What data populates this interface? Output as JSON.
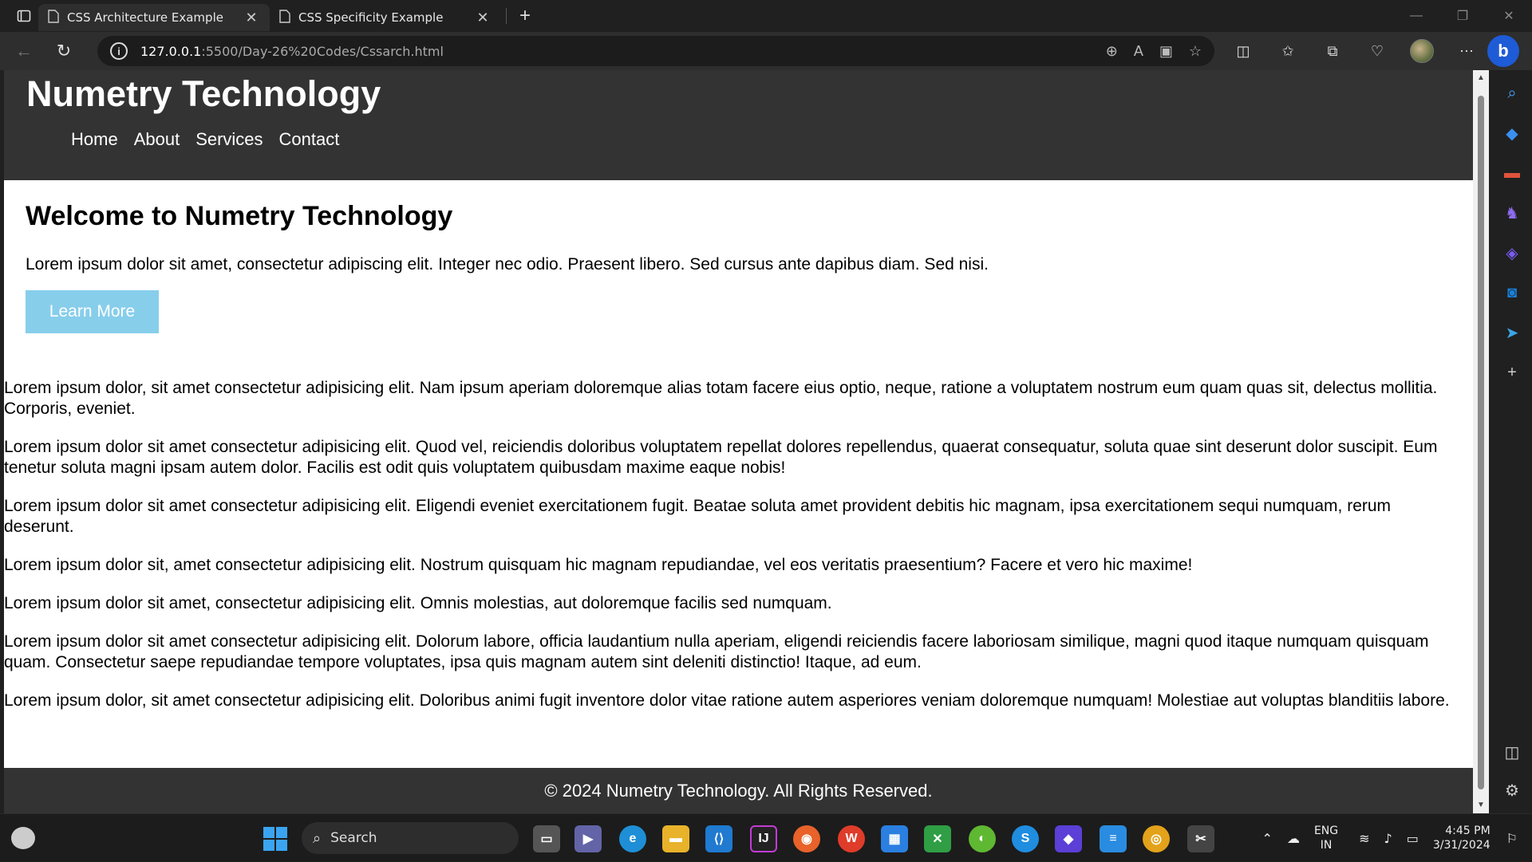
{
  "browser": {
    "tabs": [
      {
        "title": "CSS Architecture Example",
        "active": true
      },
      {
        "title": "CSS Specificity Example",
        "active": false
      }
    ],
    "url_host": "127.0.0.1",
    "url_path": ":5500/Day-26%20Codes/Cssarch.html"
  },
  "site": {
    "title": "Numetry Technology",
    "nav": [
      "Home",
      "About",
      "Services",
      "Contact"
    ],
    "hero_heading": "Welcome to Numetry Technology",
    "hero_text": "Lorem ipsum dolor sit amet, consectetur adipiscing elit. Integer nec odio. Praesent libero. Sed cursus ante dapibus diam. Sed nisi.",
    "cta_label": "Learn More",
    "paragraphs": [
      "Lorem ipsum dolor, sit amet consectetur adipisicing elit. Nam ipsum aperiam doloremque alias totam facere eius optio, neque, ratione a voluptatem nostrum eum quam quas sit, delectus mollitia. Corporis, eveniet.",
      "Lorem ipsum dolor sit amet consectetur adipisicing elit. Quod vel, reiciendis doloribus voluptatem repellat dolores repellendus, quaerat consequatur, soluta quae sint deserunt dolor suscipit. Eum tenetur soluta magni ipsam autem dolor. Facilis est odit quis voluptatem quibusdam maxime eaque nobis!",
      "Lorem ipsum dolor sit amet consectetur adipisicing elit. Eligendi eveniet exercitationem fugit. Beatae soluta amet provident debitis hic magnam, ipsa exercitationem sequi numquam, rerum deserunt.",
      "Lorem ipsum dolor sit, amet consectetur adipisicing elit. Nostrum quisquam hic magnam repudiandae, vel eos veritatis praesentium? Facere et vero hic maxime!",
      "Lorem ipsum dolor sit amet, consectetur adipisicing elit. Omnis molestias, aut doloremque facilis sed numquam.",
      "Lorem ipsum dolor sit amet consectetur adipisicing elit. Dolorum labore, officia laudantium nulla aperiam, eligendi reiciendis facere laboriosam similique, magni quod itaque numquam quisquam quam. Consectetur saepe repudiandae tempore voluptates, ipsa quis magnam autem sint deleniti distinctio! Itaque, ad eum.",
      "Lorem ipsum dolor, sit amet consectetur adipisicing elit. Doloribus animi fugit inventore dolor vitae ratione autem asperiores veniam doloremque numquam! Molestiae aut voluptas blanditiis labore."
    ],
    "footer": "© 2024 Numetry Technology. All Rights Reserved."
  },
  "taskbar": {
    "search_placeholder": "Search",
    "lang_line1": "ENG",
    "lang_line2": "IN",
    "time": "4:45 PM",
    "date": "3/31/2024"
  },
  "colors": {
    "header_bg": "#333333",
    "cta_bg": "#87ceeb",
    "browser_bg": "#202020"
  }
}
